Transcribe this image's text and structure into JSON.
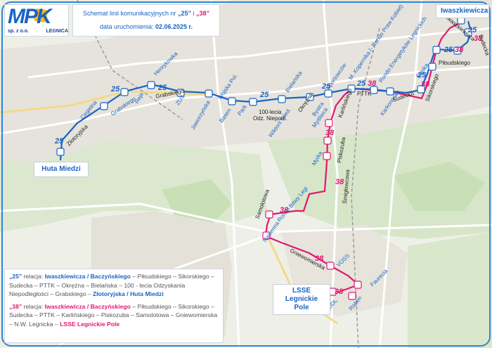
{
  "logo": {
    "main": "MPK",
    "sub_left": "sp. z o.o.",
    "sub_right": "LEGNICA"
  },
  "header": {
    "line1_prefix": "Schemat linii komunikacyjnych nr ",
    "line1_r25": "„25”",
    "line1_mid": " i ",
    "line1_r38": "„38”",
    "line2_prefix": "data uruchomienia: ",
    "line2_date": "02.06.2025 r."
  },
  "terminals": {
    "iwaszkiewicza": "Iwaszkiewicza",
    "huta": "Huta Miedzi",
    "lsse_1": "LSSE",
    "lsse_2": "Legnickie Pole"
  },
  "route_numbers": {
    "r25": "25",
    "r38": "38"
  },
  "colors": {
    "route25": "#1a63c4",
    "route38": "#e2186f",
    "frame": "#2e86d8"
  },
  "stops": {
    "cegielna": "Cegielna",
    "zlotoryjska": "Złotoryjska",
    "grabskiego1": "Grabskiego",
    "reja": "Reja",
    "hennykowka": "Henrykowka",
    "zus": "ZUS",
    "grabskiego2": "Grabskiego",
    "jaworzynska": "Jaworzyńska",
    "bason": "Basen",
    "wojska_pol": "Wojska Pol.",
    "park": "Park",
    "lecia_1": "100-lecia",
    "lecia_2": "Odz. Niepodl.",
    "bielanska": "Bielańska",
    "wiktorii_wied": "Wiktorii Wied.",
    "okrezna": "Okrężna",
    "bystra": "Bystra",
    "sportowcow": "Sportowców",
    "mysliwca": "Myśliwca",
    "kopernika": "M. Kopernika (- Rondo Praw Kobiet)",
    "karlinskiego": "Karlińskiego",
    "pttk": "PTTK",
    "rondo_energ": "Rondo Energetyków Legnickich",
    "karkonoska": "Karkonoska",
    "sudecka1": "Sudecka",
    "slaska": "Śląska",
    "sikorskiego": "Sikorskiego",
    "pilsudskiego": "Piłsudskiego",
    "iwaszkiewicza2": "Iwaszkiewicza",
    "sudecka2": "Sudecka",
    "myrka": "Myrka",
    "piskozuba": "Piskozuba",
    "smiglowcowa": "Śmigłowcowa",
    "samolotowa": "Samolotowa",
    "rondo_bitwy": "Rondo Bitwy Legi",
    "nasienna": "Nasienna",
    "gniewomierska": "Gniewomierska",
    "voss": "VOSS",
    "faurecia": "Faurecia",
    "udl": "UDL",
    "raben": "Raben"
  },
  "legend": {
    "r25_label": "„25”",
    "r25_rel": " relacja: ",
    "r25_start": "Iwaszkiewicza / Baczyńskiego",
    "r25_mid": " – Piłsudskiego – Sikorskiego – Sudecka – PTTK – Okrężna – Bielańska – 100 - lecia Odzyskania Niepodległości – Grabskiego – ",
    "r25_end": "Złotoryjska / Huta Miedzi",
    "r38_label": "„38”",
    "r38_rel": " relacja: ",
    "r38_start": "Iwaszkiewicza / Baczyńskiego",
    "r38_mid": " – Piłsudskiego – Sikorskiego – Sudecka – PTTK – Karlińskiego – Piskozuba – Samolotowa – Gniewomierska – N.W. Legnicka – ",
    "r38_end": "LSSE Legnickie Pole"
  }
}
